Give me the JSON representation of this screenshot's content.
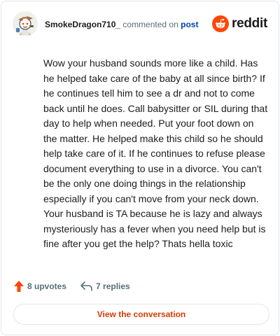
{
  "header": {
    "username": "SmokeDragon710_",
    "action_text": "commented on",
    "post_link": "post",
    "logo_text": "reddit",
    "avatar_icon": "snoo-avatar-icon",
    "logo_icon": "reddit-alien-icon"
  },
  "comment": {
    "text": "Wow your husband sounds more like a child. Has he helped take care of the baby at all since birth? If he continues tell him to see a dr and not to come back until he does. Call babysitter or SIL during that day to help when needed. Put your foot down on the matter. He helped make this child so he should help take care of it. If he continues to refuse please document everything to use in a divorce. You can't be the only one doing things in the relationship especially if you can't move from your neck down. Your husband is TA because he is lazy and always mysteriously has a fever when you need help but is fine after you get the help? Thats hella toxic"
  },
  "stats": {
    "upvotes": "8 upvotes",
    "replies": "7 replies",
    "upvote_icon": "upvote-arrow-icon",
    "reply_icon": "reply-arrow-icon"
  },
  "actions": {
    "view_conversation": "View the conversation"
  },
  "colors": {
    "brand": "#ff4500",
    "link": "#0045ac",
    "button_text": "#d93a00",
    "muted": "#576f76"
  }
}
